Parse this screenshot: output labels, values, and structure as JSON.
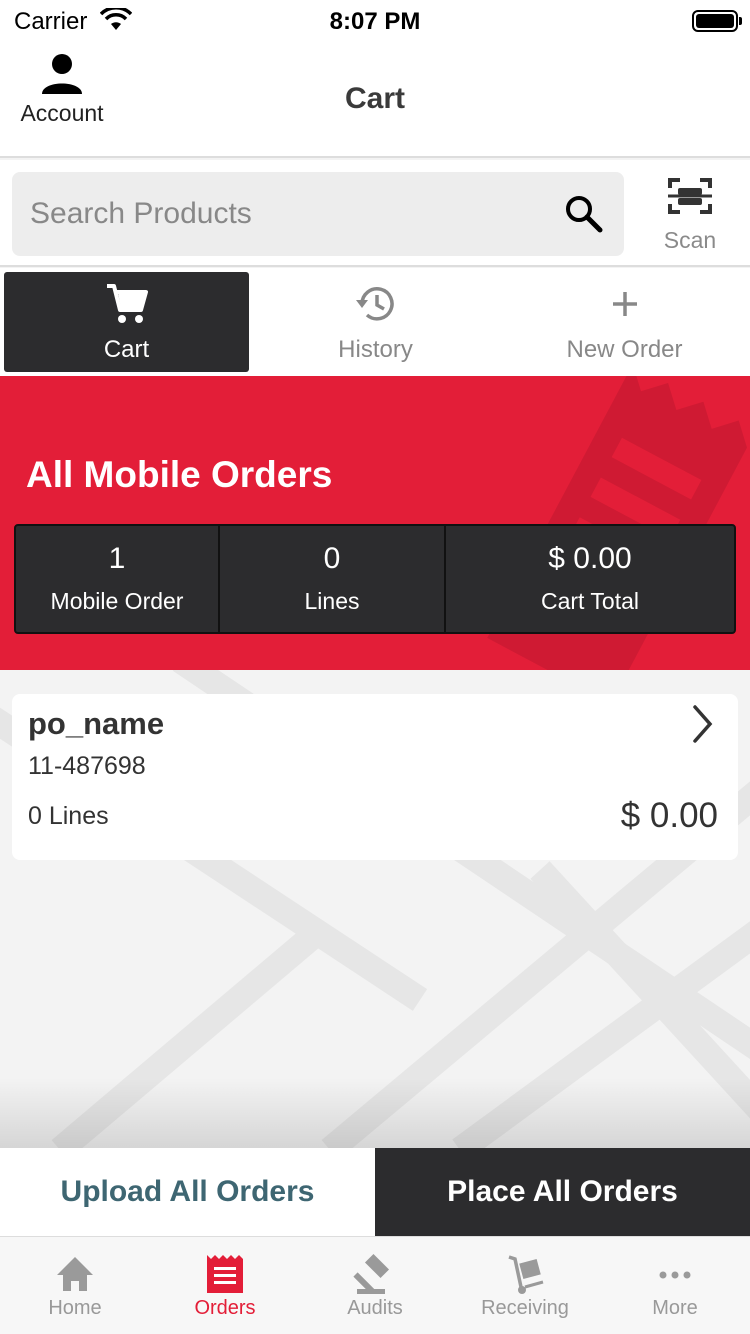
{
  "status_bar": {
    "carrier": "Carrier",
    "time": "8:07 PM"
  },
  "header": {
    "account_label": "Account",
    "title": "Cart"
  },
  "search": {
    "placeholder": "Search Products",
    "value": "",
    "scan_label": "Scan"
  },
  "tabs": [
    {
      "label": "Cart",
      "icon": "cart-icon",
      "active": true
    },
    {
      "label": "History",
      "icon": "history-icon",
      "active": false
    },
    {
      "label": "New Order",
      "icon": "plus-icon",
      "active": false
    }
  ],
  "banner": {
    "title": "All Mobile Orders",
    "stats": [
      {
        "value": "1",
        "label": "Mobile Order"
      },
      {
        "value": "0",
        "label": "Lines"
      },
      {
        "value": "$ 0.00",
        "label": "Cart Total"
      }
    ]
  },
  "orders": [
    {
      "name": "po_name",
      "number": "11-487698",
      "lines": "0 Lines",
      "total": "$ 0.00"
    }
  ],
  "actions": {
    "upload_label": "Upload All Orders",
    "place_label": "Place All Orders"
  },
  "bottom_nav": [
    {
      "label": "Home",
      "icon": "home-icon",
      "active": false
    },
    {
      "label": "Orders",
      "icon": "orders-icon",
      "active": true
    },
    {
      "label": "Audits",
      "icon": "gavel-icon",
      "active": false
    },
    {
      "label": "Receiving",
      "icon": "hand-truck-icon",
      "active": false
    },
    {
      "label": "More",
      "icon": "more-icon",
      "active": false
    }
  ],
  "colors": {
    "brand_red": "#e31e38",
    "dark": "#2c2c2e",
    "upload_text": "#3e6672"
  }
}
